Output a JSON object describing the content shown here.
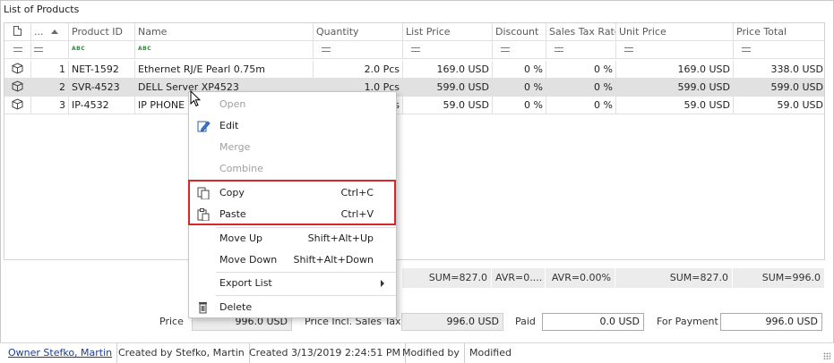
{
  "title": "List of Products",
  "columns": [
    "",
    "...",
    "Product ID",
    "Name",
    "Quantity",
    "List Price",
    "Discount",
    "Sales Tax Rate",
    "Unit Price",
    "Price Total"
  ],
  "rows": [
    {
      "num": "1",
      "id": "NET-1592",
      "name": "Ethernet RJ/E Pearl 0.75m",
      "qty": "2.0 Pcs",
      "list": "169.0 USD",
      "disc": "0 %",
      "tax": "0 %",
      "unit": "169.0 USD",
      "total": "338.0 USD"
    },
    {
      "num": "2",
      "id": "SVR-4523",
      "name": "DELL Server XP4523",
      "qty": "1.0 Pcs",
      "list": "599.0 USD",
      "disc": "0 %",
      "tax": "0 %",
      "unit": "599.0 USD",
      "total": "599.0 USD"
    },
    {
      "num": "3",
      "id": "IP-4532",
      "name": "IP PHONE W",
      "qty": "s",
      "list": "59.0 USD",
      "disc": "0 %",
      "tax": "0 %",
      "unit": "59.0 USD",
      "total": "59.0 USD"
    }
  ],
  "summary": {
    "list": "SUM=827.0",
    "disc": "AVR=0....",
    "tax": "AVR=0.00%",
    "unit": "SUM=827.0",
    "total": "SUM=996.0"
  },
  "totals": {
    "price_label": "Price",
    "price_value": "996.0 USD",
    "incl_label": "Price Incl. Sales Tax",
    "incl_value": "996.0 USD",
    "paid_label": "Paid",
    "paid_value": "0.0 USD",
    "payment_label": "For Payment",
    "payment_value": "996.0 USD"
  },
  "status": {
    "owner": "Owner Stefko, Martin",
    "created_by": "Created by Stefko, Martin",
    "created": "Created 3/13/2019 2:24:51 PM",
    "modified_by": "Modified by",
    "modified": "Modified"
  },
  "menu": {
    "open": "Open",
    "edit": "Edit",
    "merge": "Merge",
    "combine": "Combine",
    "copy": "Copy",
    "copy_sc": "Ctrl+C",
    "paste": "Paste",
    "paste_sc": "Ctrl+V",
    "move_up": "Move Up",
    "move_up_sc": "Shift+Alt+Up",
    "move_down": "Move Down",
    "move_down_sc": "Shift+Alt+Down",
    "export": "Export List",
    "delete": "Delete"
  },
  "colors": {
    "highlight": "#d7272a",
    "selected_row": "#e1e1e1",
    "abc_green": "#2d8a3a"
  }
}
